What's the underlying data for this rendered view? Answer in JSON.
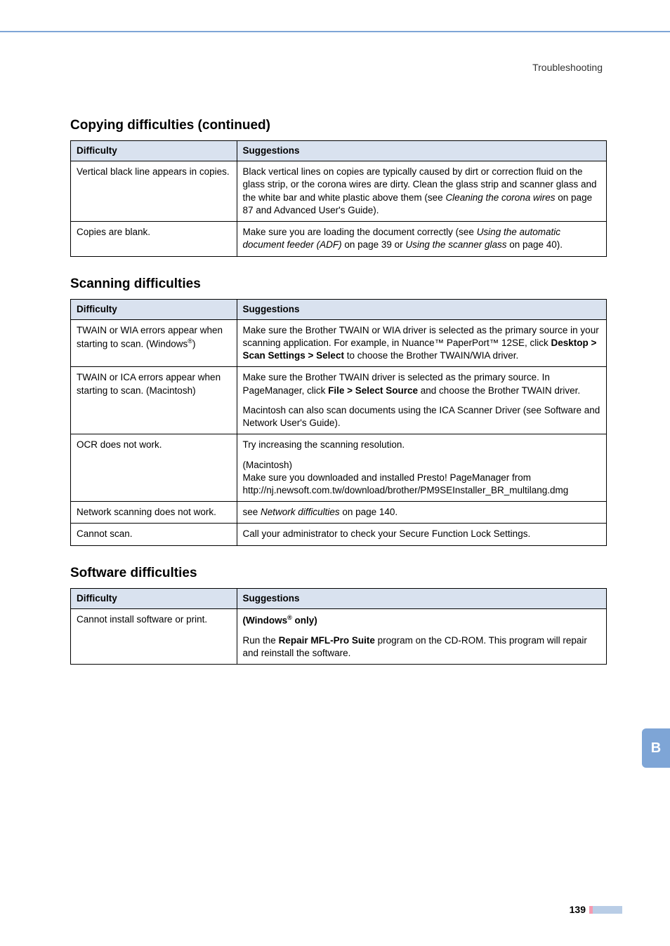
{
  "running_head": "Troubleshooting",
  "sections": {
    "copying": {
      "title": "Copying difficulties (continued)",
      "head_col1": "Difficulty",
      "head_col2": "Suggestions",
      "rows": [
        {
          "difficulty": "Vertical black line appears in copies.",
          "sugg_a": "Black vertical lines on copies are typically caused by dirt or correction fluid on the glass strip, or the corona wires are dirty. Clean the glass strip and scanner glass and the white bar and white plastic above them (see ",
          "sugg_a_ital": "Cleaning the corona wires",
          "sugg_a_tail": " on page 87 and Advanced User's Guide)."
        },
        {
          "difficulty": "Copies are blank.",
          "sugg_a": "Make sure you are loading the document correctly (see ",
          "sugg_a_ital": "Using the automatic document feeder (ADF)",
          "sugg_a_mid": " on page 39 or ",
          "sugg_a_ital2": "Using the scanner glass",
          "sugg_a_tail": " on page 40)."
        }
      ]
    },
    "scanning": {
      "title": "Scanning difficulties",
      "head_col1": "Difficulty",
      "head_col2": "Suggestions",
      "rows": {
        "r1": {
          "diff_a": "TWAIN or WIA errors appear when starting to scan. (Windows",
          "diff_sup": "®",
          "diff_b": ")",
          "sugg_a": "Make sure the Brother TWAIN or WIA driver is selected as the primary source in your scanning application. For example, in Nuance™ PaperPort™ 12SE, click ",
          "sugg_bold": "Desktop > Scan Settings > Select",
          "sugg_b": " to choose the Brother TWAIN/WIA driver."
        },
        "r2": {
          "difficulty": "TWAIN or ICA errors appear when starting to scan. (Macintosh)",
          "sugg_a": "Make sure the Brother TWAIN driver is selected as the primary source. In PageManager, click ",
          "sugg_bold": "File > Select Source",
          "sugg_b": " and choose the Brother TWAIN driver.",
          "sugg_sep": "Macintosh can also scan documents using the ICA Scanner Driver (see Software and Network User's Guide)."
        },
        "r3": {
          "difficulty": "OCR does not work.",
          "sugg_a": "Try increasing the scanning resolution.",
          "sugg_sep_a": "(Macintosh)",
          "sugg_sep_b": "Make sure you downloaded and installed Presto! PageManager from http://nj.newsoft.com.tw/download/brother/PM9SEInstaller_BR_multilang.dmg"
        },
        "r4": {
          "difficulty": "Network scanning does not work.",
          "sugg_a": "see ",
          "sugg_ital": "Network difficulties",
          "sugg_b": " on page 140."
        },
        "r5": {
          "difficulty": "Cannot scan.",
          "sugg": "Call your administrator to check your Secure Function Lock Settings."
        }
      }
    },
    "software": {
      "title": "Software difficulties",
      "head_col1": "Difficulty",
      "head_col2": "Suggestions",
      "rows": {
        "r1": {
          "difficulty": "Cannot install software or print.",
          "sugg_bold_a": "(Windows",
          "sugg_sup": "®",
          "sugg_bold_b": " only)",
          "sugg_sep_a": "Run the ",
          "sugg_sep_bold": "Repair MFL-Pro Suite",
          "sugg_sep_b": " program on the CD-ROM. This program will repair and reinstall the software."
        }
      }
    }
  },
  "side_tab": "B",
  "page_number": "139"
}
